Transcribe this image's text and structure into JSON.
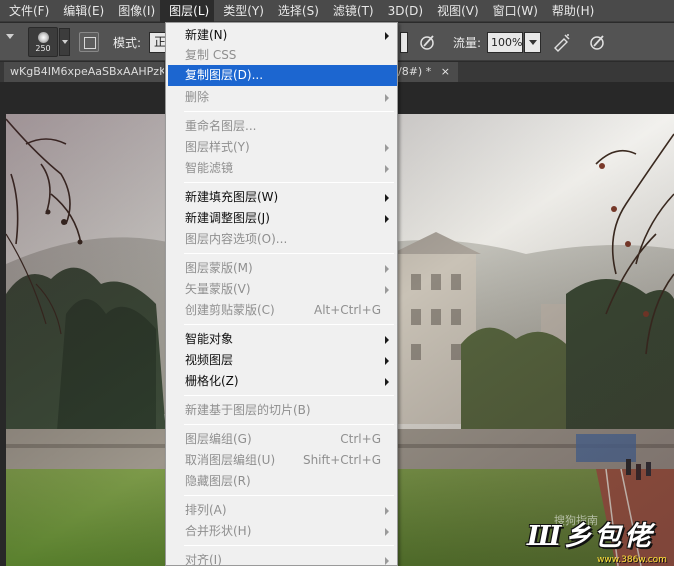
{
  "menubar": {
    "items": [
      {
        "label": "文件(F)"
      },
      {
        "label": "编辑(E)"
      },
      {
        "label": "图像(I)"
      },
      {
        "label": "图层(L)"
      },
      {
        "label": "类型(Y)"
      },
      {
        "label": "选择(S)"
      },
      {
        "label": "滤镜(T)"
      },
      {
        "label": "3D(D)"
      },
      {
        "label": "视图(V)"
      },
      {
        "label": "窗口(W)"
      },
      {
        "label": "帮助(H)"
      }
    ],
    "active_index": 3
  },
  "options": {
    "brush_size": "250",
    "mode_label": "模式:",
    "mode_value": "正",
    "flow_label": "流量:",
    "flow_value": "100%"
  },
  "document": {
    "tab_title": "wKgB4IM6xpeAaSBxAAHPzK",
    "tab_suffix": "/8#) *",
    "close_glyph": "×"
  },
  "layer_menu": {
    "items": [
      {
        "label": "新建(N)",
        "enabled": true,
        "submenu": true
      },
      {
        "label": "复制 CSS",
        "enabled": false
      },
      {
        "label": "复制图层(D)...",
        "enabled": true,
        "highlighted": true
      },
      {
        "label": "删除",
        "enabled": false,
        "submenu": true
      },
      {
        "label": "重命名图层...",
        "enabled": false
      },
      {
        "label": "图层样式(Y)",
        "enabled": false,
        "submenu": true
      },
      {
        "label": "智能滤镜",
        "enabled": false,
        "submenu": true
      },
      {
        "label": "新建填充图层(W)",
        "enabled": true,
        "submenu": true
      },
      {
        "label": "新建调整图层(J)",
        "enabled": true,
        "submenu": true
      },
      {
        "label": "图层内容选项(O)...",
        "enabled": false
      },
      {
        "label": "图层蒙版(M)",
        "enabled": false,
        "submenu": true
      },
      {
        "label": "矢量蒙版(V)",
        "enabled": false,
        "submenu": true
      },
      {
        "label": "创建剪贴蒙版(C)",
        "enabled": false,
        "shortcut": "Alt+Ctrl+G"
      },
      {
        "label": "智能对象",
        "enabled": true,
        "submenu": true
      },
      {
        "label": "视频图层",
        "enabled": true,
        "submenu": true
      },
      {
        "label": "栅格化(Z)",
        "enabled": true,
        "submenu": true
      },
      {
        "label": "新建基于图层的切片(B)",
        "enabled": false
      },
      {
        "label": "图层编组(G)",
        "enabled": false,
        "shortcut": "Ctrl+G"
      },
      {
        "label": "取消图层编组(U)",
        "enabled": false,
        "shortcut": "Shift+Ctrl+G"
      },
      {
        "label": "隐藏图层(R)",
        "enabled": false
      },
      {
        "label": "排列(A)",
        "enabled": false,
        "submenu": true
      },
      {
        "label": "合并形状(H)",
        "enabled": false,
        "submenu": true
      },
      {
        "label": "对齐(I)",
        "enabled": false,
        "submenu": true
      }
    ]
  },
  "watermark": {
    "logo_text": "Ш乡包佬",
    "url": "www.386w.com",
    "ghost_text": "搜狗指南"
  },
  "colors": {
    "menu_highlight": "#1c66d0",
    "menubar_bg": "#4a4a4a",
    "options_bg": "#535353",
    "menu_bg": "#f0f0f0",
    "disabled_text": "#8f8f8f"
  }
}
